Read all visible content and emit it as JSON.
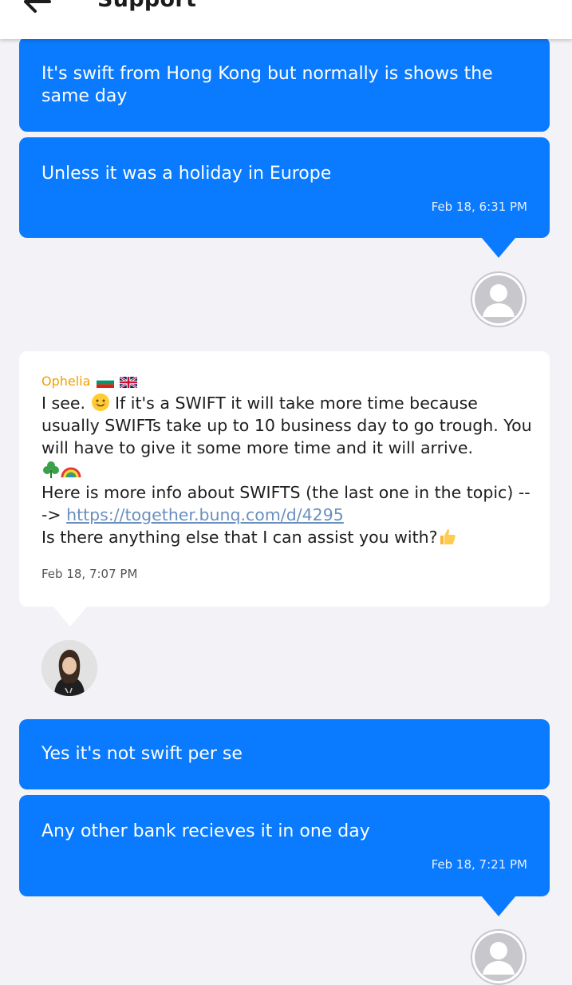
{
  "header": {
    "title": "Support",
    "back_icon": "arrow-left-icon"
  },
  "messages": [
    {
      "text": "It's swift from Hong Kong but normally is shows the same day"
    },
    {
      "text": "Unless it was a holiday in Europe",
      "time": "Feb 18, 6:31 PM"
    },
    {
      "sender": "Ophelia",
      "sender_flags": [
        "flag-bulgaria-icon",
        "flag-uk-icon"
      ],
      "line1_a": "I see. ",
      "line1_b": " If it's a SWIFT it will take more time because usually SWIFTs take up to 10 business day to go trough. You will have to give it some more time and it will arrive.",
      "emoji_icons": [
        "smiling-face-icon",
        "shamrock-icon",
        "rainbow-icon",
        "thumbs-up-icon"
      ],
      "line2": "Here is more info about SWIFTS (the last one in the topic) ---> ",
      "link": "https://together.bunq.com/d/4295",
      "line3": "Is there anything else that I can assist you with?",
      "time": "Feb 18, 7:07 PM"
    },
    {
      "text": "Yes it's not swift per se"
    },
    {
      "text": "Any other bank recieves it in one day",
      "time": "Feb 18, 7:21 PM"
    }
  ],
  "colors": {
    "outgoing_bubble": "#0a7bff",
    "incoming_bubble": "#ffffff",
    "background": "#f2f2f7",
    "sender_name": "#f0a000",
    "link": "#6a8fbf"
  }
}
